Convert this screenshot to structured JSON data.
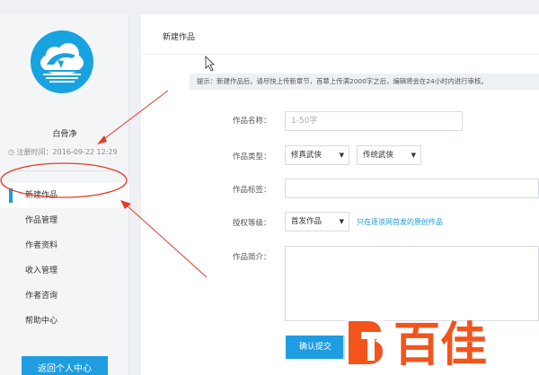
{
  "sidebar": {
    "username": "白骨净",
    "register_time": "◷ 注册时间：2016-09-22 12:29",
    "menu": [
      {
        "label": "新建作品",
        "active": true
      },
      {
        "label": "作品管理",
        "active": false
      },
      {
        "label": "作者资料",
        "active": false
      },
      {
        "label": "收入管理",
        "active": false
      },
      {
        "label": "作者咨询",
        "active": false
      },
      {
        "label": "帮助中心",
        "active": false
      }
    ],
    "back_button": "返回个人中心"
  },
  "main": {
    "title": "新建作品",
    "tip": "提示：新建作品后，请尽快上传新章节，首章上传满2000字之后，编辑将会在24小时内进行审核。",
    "form": {
      "name_label": "作品名称：",
      "name_placeholder": "1-50字",
      "type_label": "作品类型：",
      "type_main": "修真武侠",
      "type_sub": "传统武侠",
      "tags_label": "作品标签：",
      "auth_label": "授权等级：",
      "auth_value": "首发作品",
      "auth_help": "只在逐浪网首发的原创作品",
      "intro_label": "作品简介："
    },
    "submit_label": "确认提交"
  },
  "watermark": {
    "text": "百佳"
  },
  "colors": {
    "accent": "#1e9de0",
    "annotation": "#e23b2a"
  }
}
